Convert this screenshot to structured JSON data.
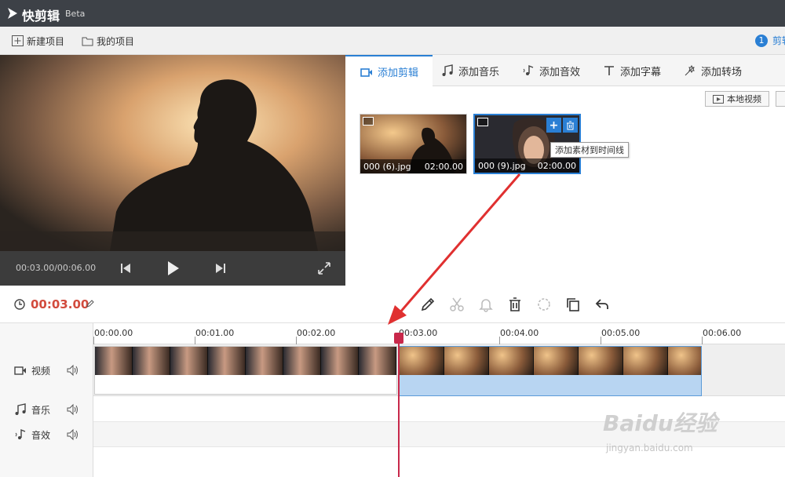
{
  "app": {
    "name": "快剪辑",
    "version_tag": "Beta"
  },
  "menu": {
    "new_project": "新建项目",
    "my_projects": "我的项目",
    "notification_count": "1",
    "notification_text": "剪辑"
  },
  "preview": {
    "time_display": "00:03.00/00:06.00"
  },
  "tabs": [
    {
      "label": "添加剪辑",
      "icon": "video-camera-icon",
      "active": true
    },
    {
      "label": "添加音乐",
      "icon": "music-note-icon",
      "active": false
    },
    {
      "label": "添加音效",
      "icon": "sound-effect-icon",
      "active": false
    },
    {
      "label": "添加字幕",
      "icon": "text-icon",
      "active": false
    },
    {
      "label": "添加转场",
      "icon": "transition-icon",
      "active": false
    }
  ],
  "media": {
    "local_video_button": "本地视频",
    "items": [
      {
        "filename": "000 (6).jpg",
        "duration": "02:00.00",
        "selected": false
      },
      {
        "filename": "000 (9).jpg",
        "duration": "02:00.00",
        "selected": true
      }
    ],
    "tooltip": "添加素材到时间线"
  },
  "toolbar": {
    "timecode": "00:03.00",
    "tools": [
      "pencil-icon",
      "scissors-icon",
      "bell-icon",
      "trash-icon",
      "crop-icon",
      "copy-icon",
      "undo-icon"
    ]
  },
  "timeline": {
    "ruler_labels": [
      "00:00.00",
      "00:01.00",
      "00:02.00",
      "00:03.00",
      "00:04.00",
      "00:05.00",
      "00:06.00"
    ],
    "tracks": [
      {
        "name": "视频",
        "icon": "video-camera-icon"
      },
      {
        "name": "音乐",
        "icon": "music-note-icon"
      },
      {
        "name": "音效",
        "icon": "sound-effect-icon"
      }
    ],
    "playhead_time": "00:03.00"
  },
  "watermark": {
    "brand": "Baidu经验",
    "url": "jingyan.baidu.com"
  },
  "colors": {
    "accent": "#2a7fd4",
    "timecode": "#d24b3d",
    "playhead": "#c8284a",
    "titlebar": "#3d4147"
  }
}
